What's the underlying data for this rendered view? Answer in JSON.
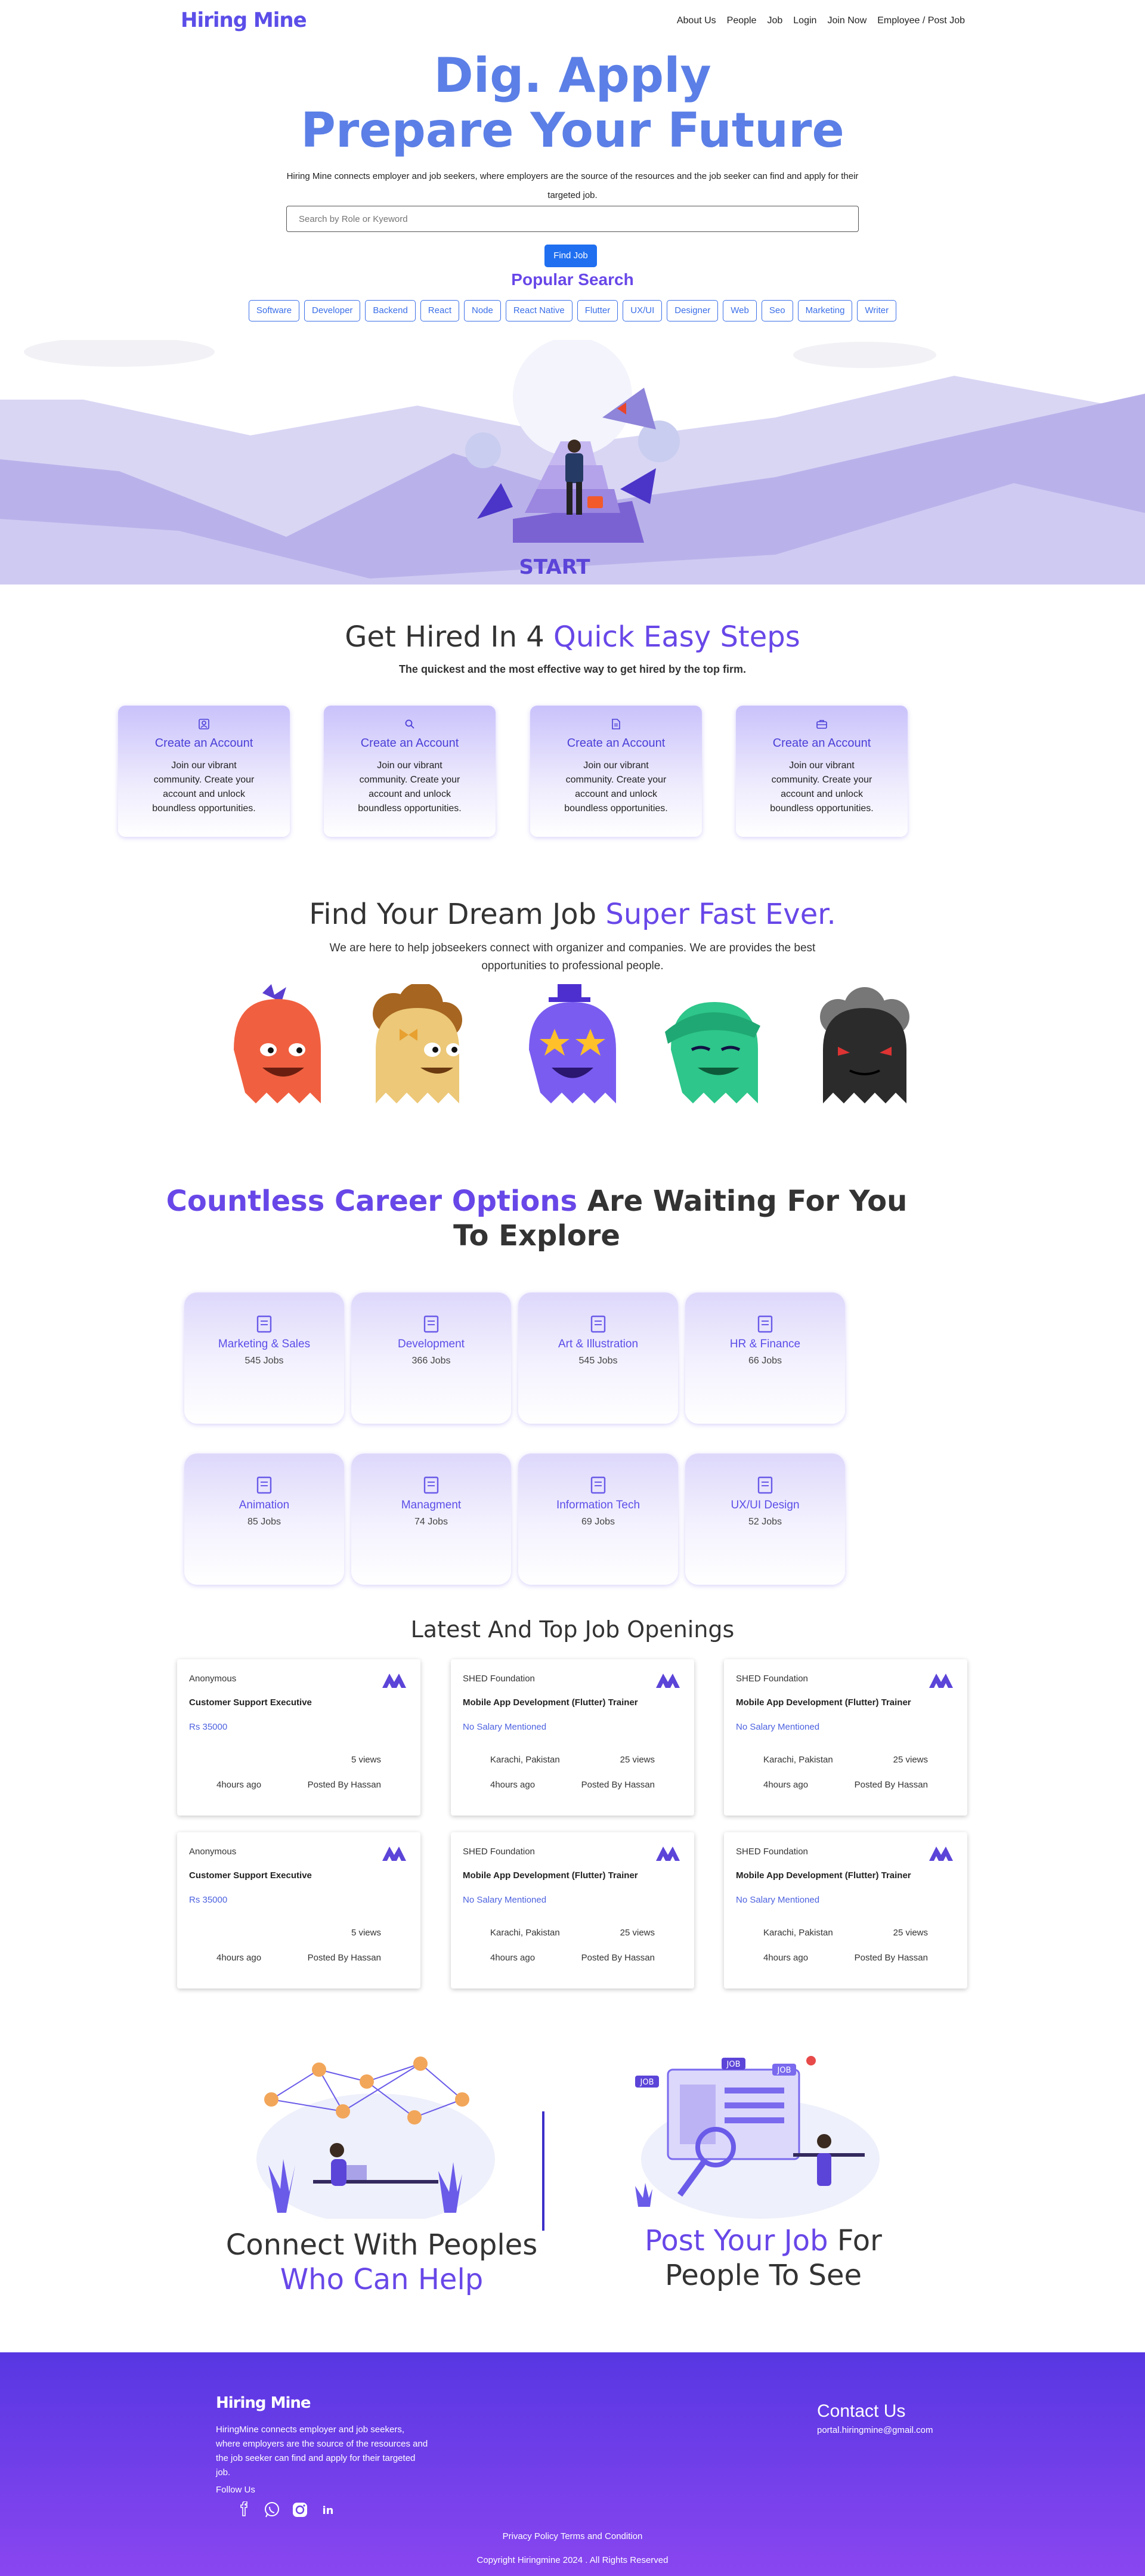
{
  "nav": {
    "logo": "Hiring Mine",
    "links": [
      "About Us",
      "People",
      "Job",
      "Login",
      "Join Now",
      "Employee / Post Job"
    ]
  },
  "hero": {
    "title_line1": "Dig. Apply",
    "title_line2": "Prepare Your Future",
    "description": "Hiring Mine connects employer and job seekers, where employers are the source of the resources and the job seeker can find and apply for their targeted job.",
    "search_placeholder": "Search by Role or Kyeword",
    "find_button": "Find Job",
    "popular_title": "Popular Search",
    "tags": [
      "Software",
      "Developer",
      "Backend",
      "React",
      "Node",
      "React Native",
      "Flutter",
      "UX/UI",
      "Designer",
      "Web",
      "Seo",
      "Marketing",
      "Writer"
    ],
    "illustration_text": "START"
  },
  "steps": {
    "title_plain": "Get Hired In 4 ",
    "title_highlight": "Quick Easy Steps",
    "subtitle": "The quickest and the most effective way to get hired by the top firm.",
    "cards": [
      {
        "icon": "user-square-icon",
        "title": "Create an Account",
        "desc": "Join our vibrant community. Create your account and unlock boundless opportunities."
      },
      {
        "icon": "search-icon",
        "title": "Create an Account",
        "desc": "Join our vibrant community. Create your account and unlock boundless opportunities."
      },
      {
        "icon": "document-icon",
        "title": "Create an Account",
        "desc": "Join our vibrant community. Create your account and unlock boundless opportunities."
      },
      {
        "icon": "briefcase-icon",
        "title": "Create an Account",
        "desc": "Join our vibrant community. Create your account and unlock boundless opportunities."
      }
    ]
  },
  "dream": {
    "title_plain": "Find Your Dream Job ",
    "title_highlight": "Super Fast Ever.",
    "subtitle": "We are here to help jobseekers connect with organizer and companies. We are provides the best opportunities to professional people."
  },
  "career": {
    "title_highlight": "Countless Career Options",
    "title_plain": " Are Waiting For You To Explore",
    "categories": [
      {
        "name": "Marketing & Sales",
        "count": "545 Jobs"
      },
      {
        "name": "Development",
        "count": "366 Jobs"
      },
      {
        "name": "Art & Illustration",
        "count": "545 Jobs"
      },
      {
        "name": "HR & Finance",
        "count": "66 Jobs"
      },
      {
        "name": "Animation",
        "count": "85 Jobs"
      },
      {
        "name": "Managment",
        "count": "74 Jobs"
      },
      {
        "name": "Information Tech",
        "count": "69 Jobs"
      },
      {
        "name": "UX/UI Design",
        "count": "52 Jobs"
      }
    ]
  },
  "jobs": {
    "title": "Latest And Top Job Openings",
    "items": [
      {
        "company": "Anonymous",
        "title": "Customer Support Executive",
        "salary": "Rs 35000",
        "location": "",
        "views": "5 views",
        "ago": "4hours ago",
        "posted_by": "Posted By Hassan"
      },
      {
        "company": "SHED Foundation",
        "title": "Mobile App Development (Flutter) Trainer",
        "salary": "No Salary Mentioned",
        "location": "Karachi, Pakistan",
        "views": "25 views",
        "ago": "4hours ago",
        "posted_by": "Posted By Hassan"
      },
      {
        "company": "SHED Foundation",
        "title": "Mobile App Development (Flutter) Trainer",
        "salary": "No Salary Mentioned",
        "location": "Karachi, Pakistan",
        "views": "25 views",
        "ago": "4hours ago",
        "posted_by": "Posted By Hassan"
      },
      {
        "company": "Anonymous",
        "title": "Customer Support Executive",
        "salary": "Rs 35000",
        "location": "",
        "views": "5 views",
        "ago": "4hours ago",
        "posted_by": "Posted By Hassan"
      },
      {
        "company": "SHED Foundation",
        "title": "Mobile App Development (Flutter) Trainer",
        "salary": "No Salary Mentioned",
        "location": "Karachi, Pakistan",
        "views": "25 views",
        "ago": "4hours ago",
        "posted_by": "Posted By Hassan"
      },
      {
        "company": "SHED Foundation",
        "title": "Mobile App Development (Flutter) Trainer",
        "salary": "No Salary Mentioned",
        "location": "Karachi, Pakistan",
        "views": "25 views",
        "ago": "4hours ago",
        "posted_by": "Posted By Hassan"
      }
    ]
  },
  "connect": {
    "left_line1": "Connect With Peoples",
    "left_line2": "Who Can Help",
    "right_highlight": "Post Your Job",
    "right_plain1": " For",
    "right_line2": "People To See",
    "illustration_badges": [
      "JOB",
      "JOB",
      "JOB"
    ]
  },
  "footer": {
    "logo": "Hiring Mine",
    "description": "HiringMine connects employer and job seekers, where employers are the source of the resources and the job seeker can find and apply for their targeted job.",
    "follow": "Follow Us",
    "social_icons": [
      "facebook-icon",
      "whatsapp-icon",
      "instagram-icon",
      "linkedin-icon"
    ],
    "contact_title": "Contact Us",
    "email": "portal.hiringmine@gmail.com",
    "policy": "Privacy Policy Terms and Condition",
    "copyright": "Copyright Hiringmine 2024 . All Rights Reserved"
  },
  "colors": {
    "brand": "#5b4ee8",
    "accent_blue": "#1f6ff0",
    "hero_title": "#5b7fe6",
    "highlight": "#6847e8"
  }
}
